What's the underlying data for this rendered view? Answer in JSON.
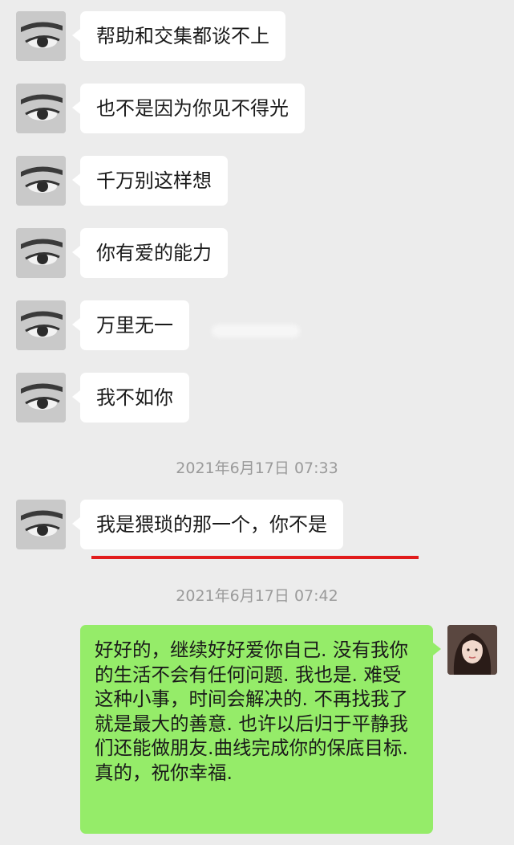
{
  "messages": [
    {
      "text": "帮助和交集都谈不上"
    },
    {
      "text": "也不是因为你见不得光"
    },
    {
      "text": "千万别这样想"
    },
    {
      "text": "你有爱的能力"
    },
    {
      "text": "万里无一"
    },
    {
      "text": "我不如你"
    },
    {
      "text": "我是猥琐的那一个，你不是"
    }
  ],
  "timestamps": [
    "2021年6月17日 07:33",
    "2021年6月17日 07:42"
  ],
  "reply": {
    "text": "好好的，继续好好爱你自己. 没有我你的生活不会有任何问题. 我也是. 难受这种小事，时间会解决的. 不再找我了就是最大的善意. 也许以后归于平静我们还能做朋友.曲线完成你的保底目标. 真的，祝你幸福."
  },
  "colors": {
    "background": "#ececec",
    "incoming_bubble": "#ffffff",
    "outgoing_bubble": "#95ec69",
    "timestamp": "#9a9a9a",
    "annotation_underline": "#e11b1b"
  }
}
